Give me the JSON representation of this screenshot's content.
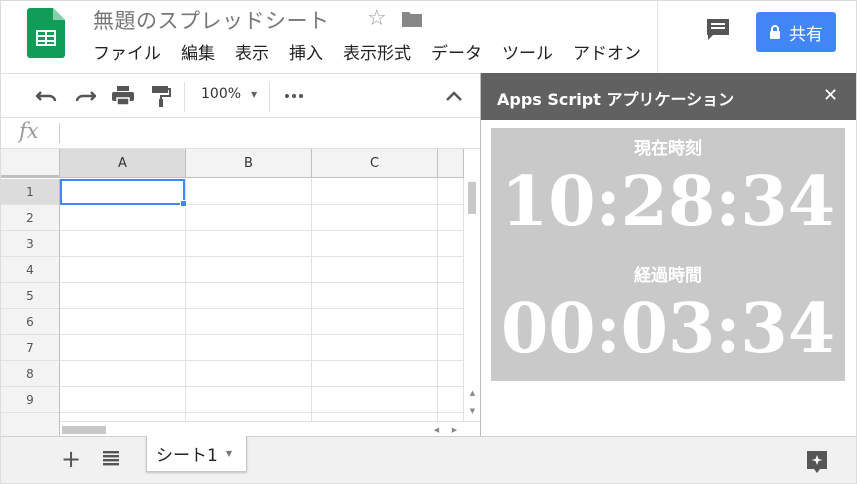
{
  "header": {
    "doc_title": "無題のスプレッドシート",
    "menu": [
      "ファイル",
      "編集",
      "表示",
      "挿入",
      "表示形式",
      "データ",
      "ツール",
      "アドオン"
    ],
    "share_label": "共有",
    "accent_color": "#4285f4"
  },
  "toolbar": {
    "zoom": "100%",
    "icons": [
      "undo-icon",
      "redo-icon",
      "print-icon",
      "paint-format-icon",
      "more-icon",
      "collapse-icon"
    ]
  },
  "formula_bar": {
    "fx_label": "fx",
    "value": ""
  },
  "grid": {
    "columns": [
      "A",
      "B",
      "C"
    ],
    "rows": [
      "1",
      "2",
      "3",
      "4",
      "5",
      "6",
      "7",
      "8",
      "9"
    ],
    "active_cell": "A1"
  },
  "sidebar": {
    "title": "Apps Script アプリケーション",
    "close_label": "✕",
    "current_time_label": "現在時刻",
    "current_time": "10:28:34",
    "elapsed_label": "経過時間",
    "elapsed_time": "00:03:34",
    "header_color": "#616161",
    "panel_color": "#c9c9c9"
  },
  "bottom": {
    "add_label": "+",
    "sheet_name": "シート1"
  }
}
